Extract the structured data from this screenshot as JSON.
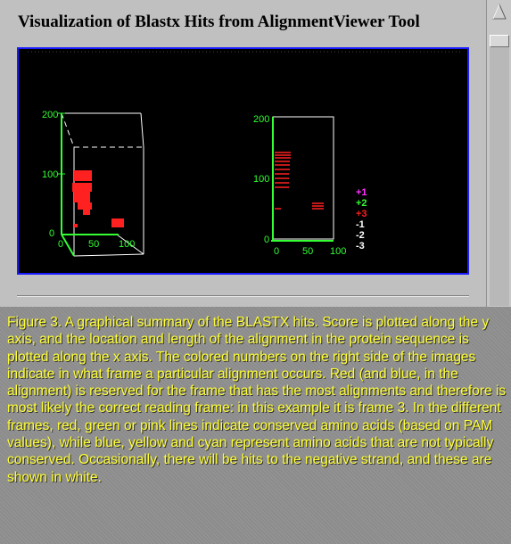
{
  "page": {
    "title": "Visualization of Blastx Hits from AlignmentViewer Tool"
  },
  "viewer": {
    "left_plot": {
      "y_ticks": [
        "200",
        "100",
        "0"
      ],
      "x_ticks": [
        "0",
        "50",
        "100"
      ]
    },
    "right_plot": {
      "y_ticks": [
        "200",
        "100",
        "0"
      ],
      "x_ticks": [
        "0",
        "50",
        "100"
      ]
    },
    "frame_legend": [
      {
        "label": "+1",
        "color": "#ff33ff"
      },
      {
        "label": "+2",
        "color": "#33ff33"
      },
      {
        "label": "+3",
        "color": "#ff2020"
      },
      {
        "label": "-1",
        "color": "#ffffff"
      },
      {
        "label": "-2",
        "color": "#ffffff"
      },
      {
        "label": "-3",
        "color": "#ffffff"
      }
    ],
    "colors": {
      "background": "#000000",
      "axis_green": "#33ff33",
      "box_white": "#ffffff",
      "hit_red": "#ff2020",
      "frame_border": "#1a1aff"
    }
  },
  "caption": {
    "text": "Figure 3. A graphical summary of the BLASTX hits.  Score is plotted along the y axis, and the location and length of the alignment in the protein sequence is plotted along the x axis.  The colored numbers on the right side of the images indicate in what frame a particular alignment occurs.  Red (and blue, in the alignment) is reserved for the frame that has the most alignments and therefore is most likely the correct reading frame: in this example it is frame 3.  In the different frames, red, green or pink lines indicate conserved amino acids (based on PAM values), while blue, yellow and cyan represent amino acids that are not typically conserved. Occasionally, there will be hits to the negative strand, and these are shown in white.",
    "color": "#ffff33"
  },
  "scrollbar": {
    "up_icon": "triangle-up-icon"
  }
}
